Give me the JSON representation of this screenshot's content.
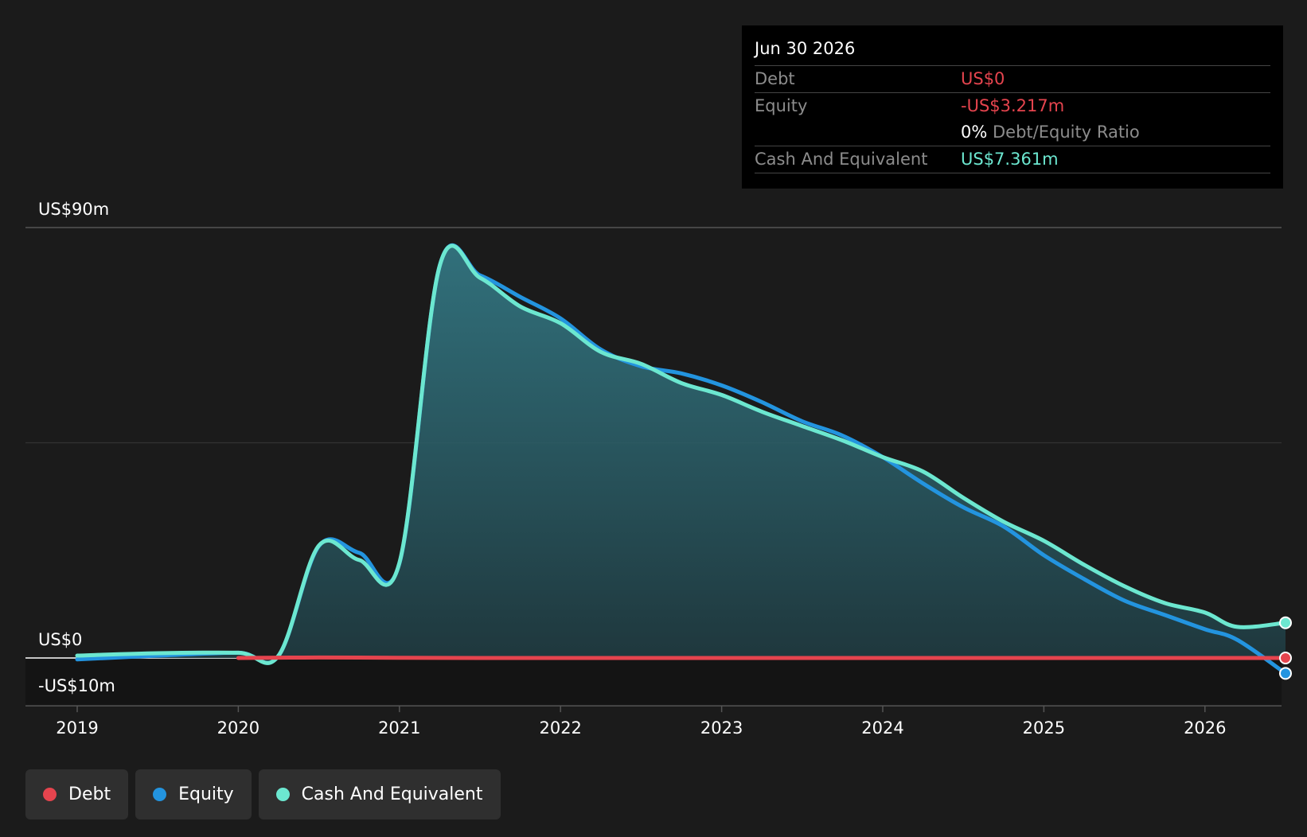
{
  "tooltip": {
    "date": "Jun 30 2026",
    "debt_label": "Debt",
    "debt_value": "US$0",
    "equity_label": "Equity",
    "equity_value": "-US$3.217m",
    "ratio_value": "0%",
    "ratio_label": "Debt/Equity Ratio",
    "cash_label": "Cash And Equivalent",
    "cash_value": "US$7.361m"
  },
  "legend": [
    {
      "label": "Debt",
      "color": "#e5444e"
    },
    {
      "label": "Equity",
      "color": "#2394df"
    },
    {
      "label": "Cash And Equivalent",
      "color": "#6ce7d0"
    }
  ],
  "colors": {
    "debt": "#e5444e",
    "equity": "#2394df",
    "cash": "#6ce7d0",
    "background": "#1b1b1b"
  },
  "chart_data": {
    "type": "area",
    "title": "",
    "xlabel": "",
    "ylabel": "",
    "ylim": [
      -10,
      90
    ],
    "y_tick_labels": [
      "US$90m",
      "US$0",
      "-US$10m"
    ],
    "x_tick_labels": [
      "2019",
      "2020",
      "2021",
      "2022",
      "2023",
      "2024",
      "2025",
      "2026"
    ],
    "x_ticks": [
      2019,
      2020,
      2021,
      2022,
      2023,
      2024,
      2025,
      2026
    ],
    "xlim": [
      2018.68,
      2026.5
    ],
    "grid": true,
    "legend_position": "bottom-left",
    "series": [
      {
        "name": "Debt",
        "color": "#e5444e",
        "x": [
          2020.0,
          2020.5,
          2021.0,
          2021.5,
          2022.0,
          2023.0,
          2024.0,
          2025.0,
          2026.0,
          2026.5
        ],
        "y": [
          0.0,
          0.1,
          0.05,
          0.0,
          0.0,
          0.0,
          0.0,
          0.0,
          0.0,
          0.0
        ]
      },
      {
        "name": "Equity",
        "color": "#2394df",
        "x": [
          2019.0,
          2019.5,
          2020.0,
          2020.25,
          2020.5,
          2020.75,
          2021.0,
          2021.25,
          2021.5,
          2021.75,
          2022.0,
          2022.25,
          2022.5,
          2022.75,
          2023.0,
          2023.25,
          2023.5,
          2023.75,
          2024.0,
          2024.25,
          2024.5,
          2024.75,
          2025.0,
          2025.25,
          2025.5,
          2025.75,
          2026.0,
          2026.2,
          2026.5
        ],
        "y": [
          -0.3,
          0.5,
          1.1,
          0.5,
          23.4,
          22.0,
          19.8,
          82.0,
          80.0,
          75.5,
          71.0,
          64.5,
          61.0,
          59.5,
          57.0,
          53.5,
          49.5,
          46.5,
          42.0,
          36.5,
          31.5,
          27.5,
          21.5,
          16.5,
          12.0,
          9.0,
          6.0,
          3.8,
          -3.217
        ]
      },
      {
        "name": "Cash And Equivalent",
        "color": "#6ce7d0",
        "x": [
          2019.0,
          2019.5,
          2020.0,
          2020.25,
          2020.5,
          2020.75,
          2021.0,
          2021.25,
          2021.5,
          2021.75,
          2022.0,
          2022.25,
          2022.5,
          2022.75,
          2023.0,
          2023.25,
          2023.5,
          2023.75,
          2024.0,
          2024.25,
          2024.5,
          2024.75,
          2025.0,
          2025.25,
          2025.5,
          2025.75,
          2026.0,
          2026.2,
          2026.5
        ],
        "y": [
          0.5,
          1.0,
          1.1,
          0.5,
          23.5,
          20.5,
          19.9,
          82.0,
          79.5,
          73.5,
          70.0,
          64.0,
          61.5,
          57.5,
          55.0,
          51.5,
          48.5,
          45.5,
          42.0,
          39.0,
          33.5,
          28.5,
          24.5,
          19.5,
          15.0,
          11.5,
          9.5,
          6.5,
          7.361
        ]
      }
    ]
  }
}
